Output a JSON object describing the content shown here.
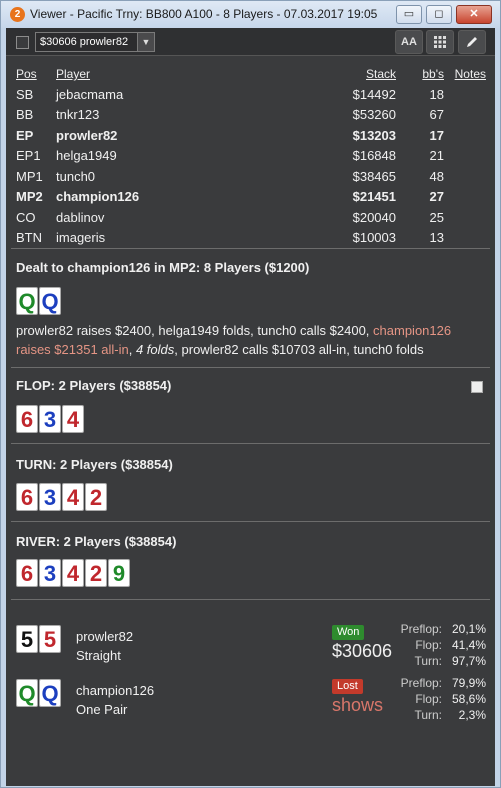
{
  "window": {
    "app_icon": "2",
    "title": "Viewer - Pacific Trny: BB800 A100 - 8 Players - 07.03.2017 19:05",
    "minimize": "▭",
    "maximize": "◻",
    "close": "✕"
  },
  "toolbar": {
    "hand_select": "$30606 prowler82",
    "font_button": "AA",
    "grid_button": "grid-icon",
    "edit_button": "pencil-icon"
  },
  "table": {
    "headers": {
      "pos": "Pos",
      "player": "Player",
      "stack": "Stack",
      "bbs": "bb's",
      "notes": "Notes"
    },
    "rows": [
      {
        "pos": "SB",
        "name": "jebacmama",
        "stack": "$14492",
        "bbs": "18",
        "bold": false
      },
      {
        "pos": "BB",
        "name": "tnkr123",
        "stack": "$53260",
        "bbs": "67",
        "bold": false
      },
      {
        "pos": "EP",
        "name": "prowler82",
        "stack": "$13203",
        "bbs": "17",
        "bold": true
      },
      {
        "pos": "EP1",
        "name": "helga1949",
        "stack": "$16848",
        "bbs": "21",
        "bold": false
      },
      {
        "pos": "MP1",
        "name": "tunch0",
        "stack": "$38465",
        "bbs": "48",
        "bold": false
      },
      {
        "pos": "MP2",
        "name": "champion126",
        "stack": "$21451",
        "bbs": "27",
        "bold": true
      },
      {
        "pos": "CO",
        "name": "dablinov",
        "stack": "$20040",
        "bbs": "25",
        "bold": false
      },
      {
        "pos": "BTN",
        "name": "imageris",
        "stack": "$10003",
        "bbs": "13",
        "bold": false
      }
    ]
  },
  "preflop": {
    "title": "Dealt to champion126 in MP2: 8 Players ($1200)",
    "hole_cards": [
      {
        "rank": "Q",
        "color": "green"
      },
      {
        "rank": "Q",
        "color": "blue"
      }
    ],
    "action_part1": "prowler82 raises $2400, helga1949 folds, tunch0 calls $2400, ",
    "action_hl": "champion126 raises $21351 all-in",
    "action_part2": ", ",
    "action_italic": "4 folds",
    "action_part3": ", prowler82 calls $10703 all-in, tunch0 folds"
  },
  "flop": {
    "title": "FLOP: 2 Players ($38854)",
    "cards": [
      {
        "rank": "6",
        "color": "red"
      },
      {
        "rank": "3",
        "color": "blue"
      },
      {
        "rank": "4",
        "color": "red"
      }
    ]
  },
  "turn": {
    "title": "TURN: 2 Players ($38854)",
    "cards": [
      {
        "rank": "6",
        "color": "red"
      },
      {
        "rank": "3",
        "color": "blue"
      },
      {
        "rank": "4",
        "color": "red"
      },
      {
        "rank": "2",
        "color": "red"
      }
    ]
  },
  "river": {
    "title": "RIVER: 2 Players ($38854)",
    "cards": [
      {
        "rank": "6",
        "color": "red"
      },
      {
        "rank": "3",
        "color": "blue"
      },
      {
        "rank": "4",
        "color": "red"
      },
      {
        "rank": "2",
        "color": "red"
      },
      {
        "rank": "9",
        "color": "green"
      }
    ]
  },
  "results": [
    {
      "cards": [
        {
          "rank": "5",
          "color": "black"
        },
        {
          "rank": "5",
          "color": "red"
        }
      ],
      "name": "prowler82",
      "hand": "Straight",
      "badge": "Won",
      "amount": "$30606",
      "equity": [
        {
          "label": "Preflop:",
          "value": "20,1%"
        },
        {
          "label": "Flop:",
          "value": "41,4%"
        },
        {
          "label": "Turn:",
          "value": "97,7%"
        }
      ]
    },
    {
      "cards": [
        {
          "rank": "Q",
          "color": "green"
        },
        {
          "rank": "Q",
          "color": "blue"
        }
      ],
      "name": "champion126",
      "hand": "One Pair",
      "badge": "Lost",
      "amount": "shows",
      "equity": [
        {
          "label": "Preflop:",
          "value": "79,9%"
        },
        {
          "label": "Flop:",
          "value": "58,6%"
        },
        {
          "label": "Turn:",
          "value": "2,3%"
        }
      ]
    }
  ]
}
